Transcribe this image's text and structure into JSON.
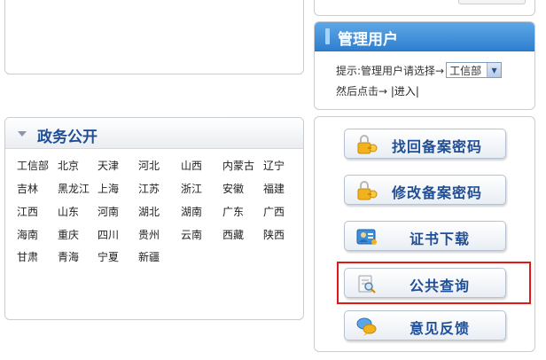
{
  "manage": {
    "title": "管理用户",
    "hint": "提示:管理用户请选择→",
    "selected_department": "工信部",
    "then_click": "然后点击→",
    "enter_link": "|进入|"
  },
  "gov": {
    "title": "政务公开",
    "rows": [
      [
        "工信部",
        "北京",
        "天津",
        "河北",
        "山西",
        "内蒙古",
        "辽宁"
      ],
      [
        "吉林",
        "黑龙江",
        "上海",
        "江苏",
        "浙江",
        "安徽",
        "福建"
      ],
      [
        "江西",
        "山东",
        "河南",
        "湖北",
        "湖南",
        "广东",
        "广西"
      ],
      [
        "海南",
        "重庆",
        "四川",
        "贵州",
        "云南",
        "西藏",
        "陕西"
      ],
      [
        "甘肃",
        "青海",
        "宁夏",
        "新疆"
      ]
    ]
  },
  "buttons": {
    "recover_password": "找回备案密码",
    "change_password": "修改备案密码",
    "cert_download": "证书下载",
    "public_query": "公共查询",
    "feedback": "意见反馈"
  },
  "colors": {
    "accent_blue": "#1f4e96",
    "header_blue": "#2e7fcf",
    "highlight_red": "#e01818"
  },
  "icons": {
    "recover": "lock-key-icon",
    "change": "lock-key-icon",
    "cert": "certificate-person-icon",
    "query": "document-search-icon",
    "feedback": "chat-bubbles-icon"
  }
}
